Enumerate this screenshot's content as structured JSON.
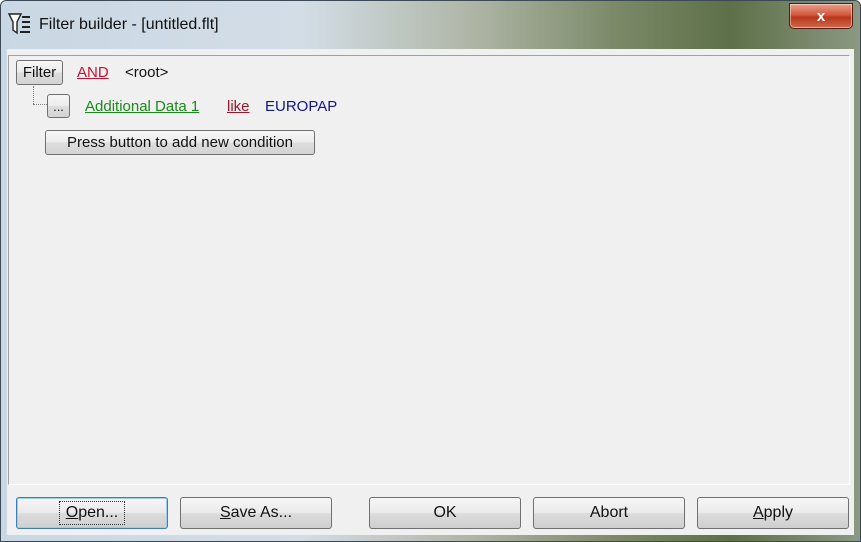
{
  "window": {
    "title": "Filter builder - [untitled.flt]",
    "close_glyph": "x",
    "icon": "filter-funnel-icon"
  },
  "tree": {
    "root": {
      "filter_button_label": "Filter",
      "operator": "AND",
      "node_label": "<root>"
    },
    "conditions": [
      {
        "ellipsis_label": "...",
        "field": "Additional Data 1",
        "comparator": "like",
        "value": "EUROPAP"
      }
    ],
    "add_condition_label": "Press button to add new condition"
  },
  "buttons": {
    "open": {
      "mnemonic": "O",
      "rest": "pen..."
    },
    "save_as": {
      "mnemonic": "S",
      "rest": "ave As..."
    },
    "ok": "OK",
    "abort": "Abort",
    "apply": {
      "mnemonic": "A",
      "rest": "pply"
    }
  },
  "colors": {
    "operator_red": "#c8102e",
    "field_green": "#1a8a1a",
    "comparator_maroon": "#a0142a",
    "value_blue": "#14148c"
  }
}
